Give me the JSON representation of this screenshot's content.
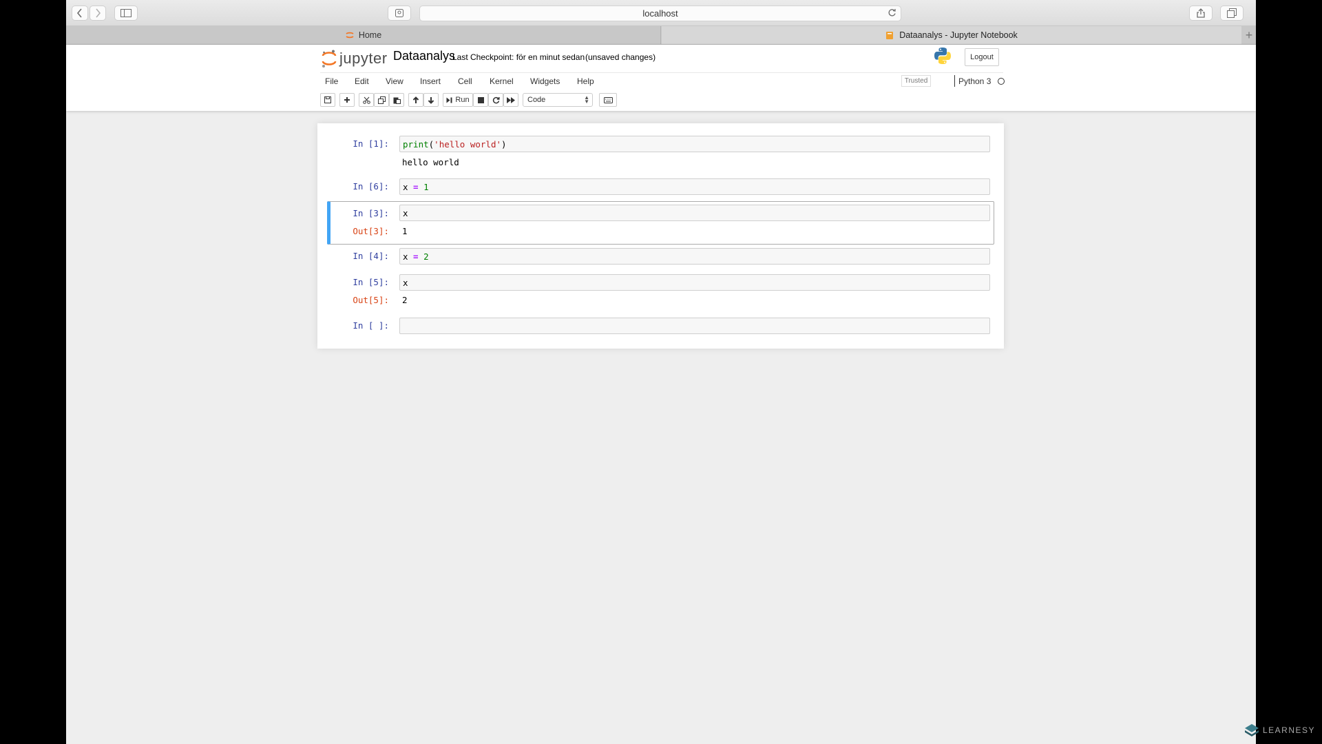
{
  "browser": {
    "address": "localhost",
    "tabs": [
      {
        "label": "Home",
        "active": false
      },
      {
        "label": "Dataanalys - Jupyter Notebook",
        "active": true
      }
    ]
  },
  "header": {
    "logo_text": "jupyter",
    "notebook_name": "Dataanalys",
    "checkpoint": "Last Checkpoint: för en minut sedan",
    "unsaved": "(unsaved changes)",
    "logout": "Logout"
  },
  "menu": [
    "File",
    "Edit",
    "View",
    "Insert",
    "Cell",
    "Kernel",
    "Widgets",
    "Help"
  ],
  "status": {
    "trusted": "Trusted",
    "kernel": "Python 3"
  },
  "toolbar": {
    "run_label": "Run",
    "cell_type": "Code"
  },
  "cells": [
    {
      "in_prompt": "In [1]:",
      "code": [
        "print",
        "(",
        "'hello world'",
        ")"
      ],
      "stream": "hello world"
    },
    {
      "in_prompt": "In [6]:",
      "code": [
        "x",
        " = ",
        "1"
      ]
    },
    {
      "in_prompt": "In [3]:",
      "code": [
        "x"
      ],
      "out_prompt": "Out[3]:",
      "result": "1"
    },
    {
      "in_prompt": "In [4]:",
      "code": [
        "x",
        " = ",
        "2"
      ]
    },
    {
      "in_prompt": "In [5]:",
      "code": [
        "x"
      ],
      "out_prompt": "Out[5]:",
      "result": "2"
    },
    {
      "in_prompt": "In [ ]:",
      "code": [
        ""
      ]
    }
  ],
  "watermark": "LEARNESY",
  "colors": {
    "selected_cell_accent": "#42a5f5",
    "in_prompt": "#303f9f",
    "out_prompt": "#d84315"
  }
}
